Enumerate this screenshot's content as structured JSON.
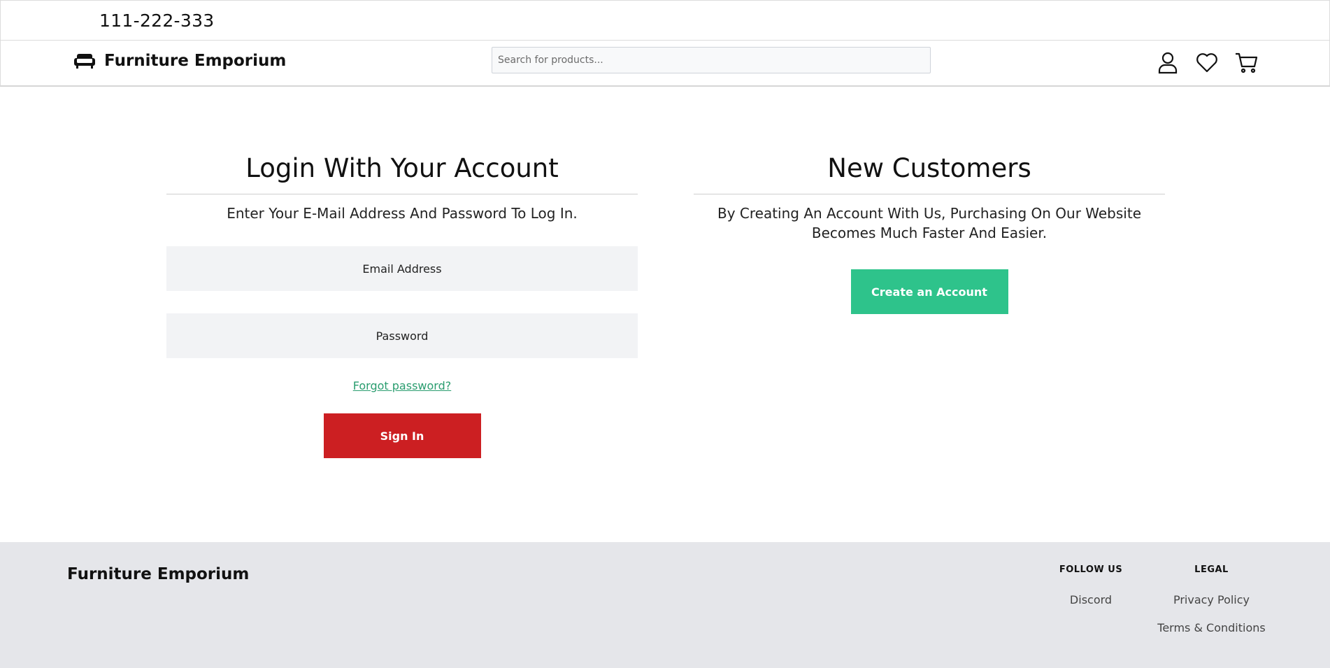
{
  "topbar": {
    "phone": "111-222-333"
  },
  "header": {
    "brand": "Furniture Emporium",
    "search_placeholder": "Search for products...",
    "icons": [
      "user-icon",
      "heart-icon",
      "cart-icon"
    ]
  },
  "login": {
    "title": "Login With Your Account",
    "subtitle": "Enter Your E-Mail Address And Password To Log In.",
    "email_placeholder": "Email Address",
    "password_placeholder": "Password",
    "forgot_label": "Forgot password?",
    "signin_label": "Sign In"
  },
  "new_customers": {
    "title": "New Customers",
    "subtitle": "By Creating An Account With Us, Purchasing On Our Website Becomes Much Faster And Easier.",
    "create_label": "Create an Account"
  },
  "footer": {
    "brand": "Furniture Emporium",
    "follow_heading": "FOLLOW US",
    "follow_links": [
      "Discord"
    ],
    "legal_heading": "LEGAL",
    "legal_links": [
      "Privacy Policy",
      "Terms & Conditions"
    ]
  },
  "colors": {
    "signin": "#cc1f22",
    "create": "#2ec38b",
    "link": "#2a9d6f",
    "footer_bg": "#e5e6ea"
  }
}
